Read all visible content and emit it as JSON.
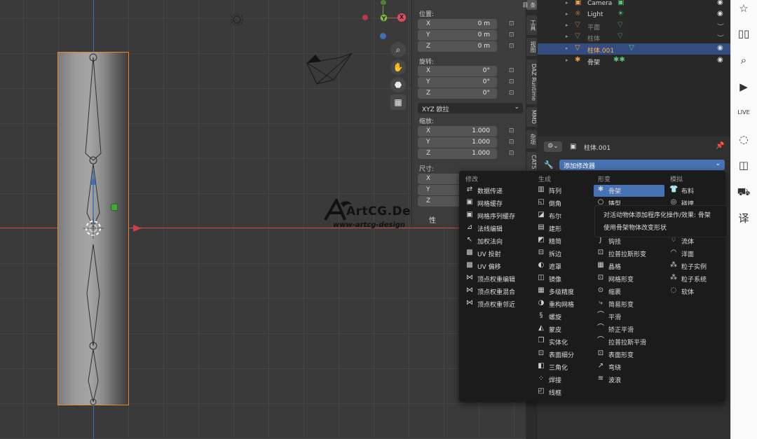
{
  "outliner": {
    "rows": [
      {
        "name": "Camera"
      },
      {
        "name": "Light"
      },
      {
        "name": "平面"
      },
      {
        "name": "柱体"
      },
      {
        "name": "柱体.001"
      },
      {
        "name": "骨架"
      }
    ]
  },
  "npanel": {
    "location_label": "位置:",
    "rotation_label": "旋转:",
    "scale_label": "缩放:",
    "dimensions_label": "尺寸:",
    "axes": [
      "X",
      "Y",
      "Z"
    ],
    "location": [
      "0 m",
      "0 m",
      "0 m"
    ],
    "rotation": [
      "0°",
      "0°",
      "0°"
    ],
    "scale": [
      "1.000",
      "1.000",
      "1.000"
    ],
    "rotation_mode": "XYZ 欧拉",
    "tab_fragment": "性"
  },
  "tabs": [
    "条目",
    "工具",
    "视图",
    "DAZ Runtime",
    "MMD",
    "杂项",
    "CATS"
  ],
  "properties": {
    "object_name": "柱体.001",
    "add_modifier": "添加修改器"
  },
  "gizmo": {
    "x": "X",
    "y": "Y"
  },
  "menu": {
    "columns": [
      "修改",
      "生成",
      "形变",
      "模拟"
    ],
    "modify": [
      "数据传递",
      "网格缓存",
      "网格序列缓存",
      "法线编辑",
      "加权法向",
      "UV 投射",
      "UV 偏移",
      "顶点权重编辑",
      "顶点权重混合",
      "顶点权重邻近"
    ],
    "generate": [
      "阵列",
      "倒角",
      "布尔",
      "建形",
      "精简",
      "拆边",
      "遮罩",
      "镜像",
      "多级精度",
      "重构网格",
      "螺旋",
      "蒙皮",
      "实体化",
      "表面细分",
      "三角化",
      "焊接",
      "线框"
    ],
    "deform": [
      "骨架",
      "铸型",
      "",
      "",
      "钩挂",
      "拉普拉斯形变",
      "晶格",
      "网格形变",
      "缩裹",
      "简易形变",
      "平滑",
      "矫正平滑",
      "拉普拉斯平滑",
      "表面形变",
      "弯绕",
      "波浪"
    ],
    "simulate": [
      "布料",
      "碰撞",
      "",
      "",
      "流体",
      "洋面",
      "粒子实例",
      "粒子系统",
      "软体"
    ]
  },
  "tooltip": {
    "line1": "对活动物体添加程序化操作/效果: 骨架",
    "line2": "使用骨架物体改变形状"
  },
  "watermark": {
    "title": "ArtCG.Design",
    "url": "www-artcg-design"
  },
  "colors": {
    "accent": "#4772b3",
    "selection": "#e8862a",
    "x_axis": "#c8414b",
    "y_axis": "#3f6fb8"
  }
}
